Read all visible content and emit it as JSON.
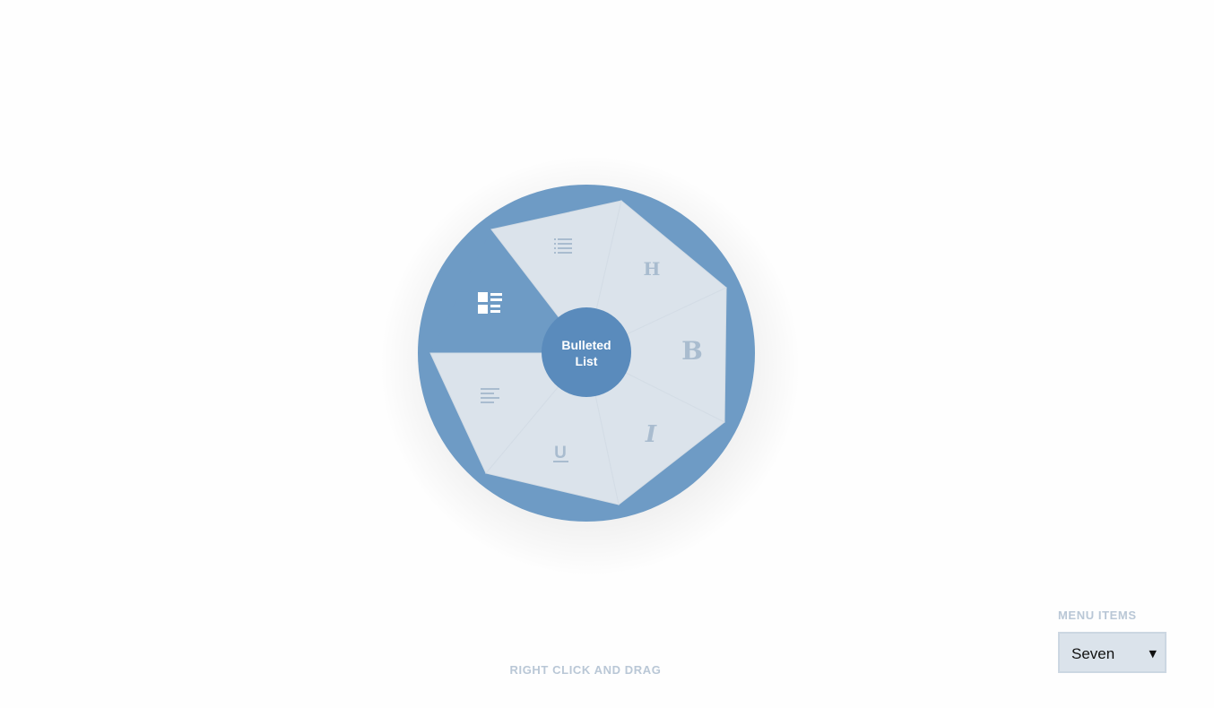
{
  "radial_menu": {
    "center_label_line1": "Bulleted",
    "center_label_line2": "List",
    "items": [
      {
        "name": "bulleted-list",
        "icon": "bulleted-list-icon",
        "state": "active"
      },
      {
        "name": "numbered-list",
        "icon": "list-icon",
        "state": "normal"
      },
      {
        "name": "heading",
        "icon": "heading-icon",
        "glyph": "H",
        "state": "normal"
      },
      {
        "name": "bold",
        "icon": "bold-icon",
        "glyph": "B",
        "state": "normal"
      },
      {
        "name": "italic",
        "icon": "italic-icon",
        "glyph": "I",
        "state": "normal"
      },
      {
        "name": "underline",
        "icon": "underline-icon",
        "glyph": "U",
        "state": "normal"
      },
      {
        "name": "align-left",
        "icon": "align-left-icon",
        "state": "normal"
      }
    ]
  },
  "hint_text": "RIGHT CLICK AND DRAG",
  "menu_items_control": {
    "label": "MENU ITEMS",
    "value": "Seven"
  },
  "colors": {
    "ring": "#6e9bc5",
    "active_slice": "#6e9bc5",
    "slice_fill": "#dbe3eb",
    "center": "#5a8bbc",
    "icon": "#a9bccf",
    "active_icon": "#ffffff",
    "hint": "#b9c7d6"
  }
}
